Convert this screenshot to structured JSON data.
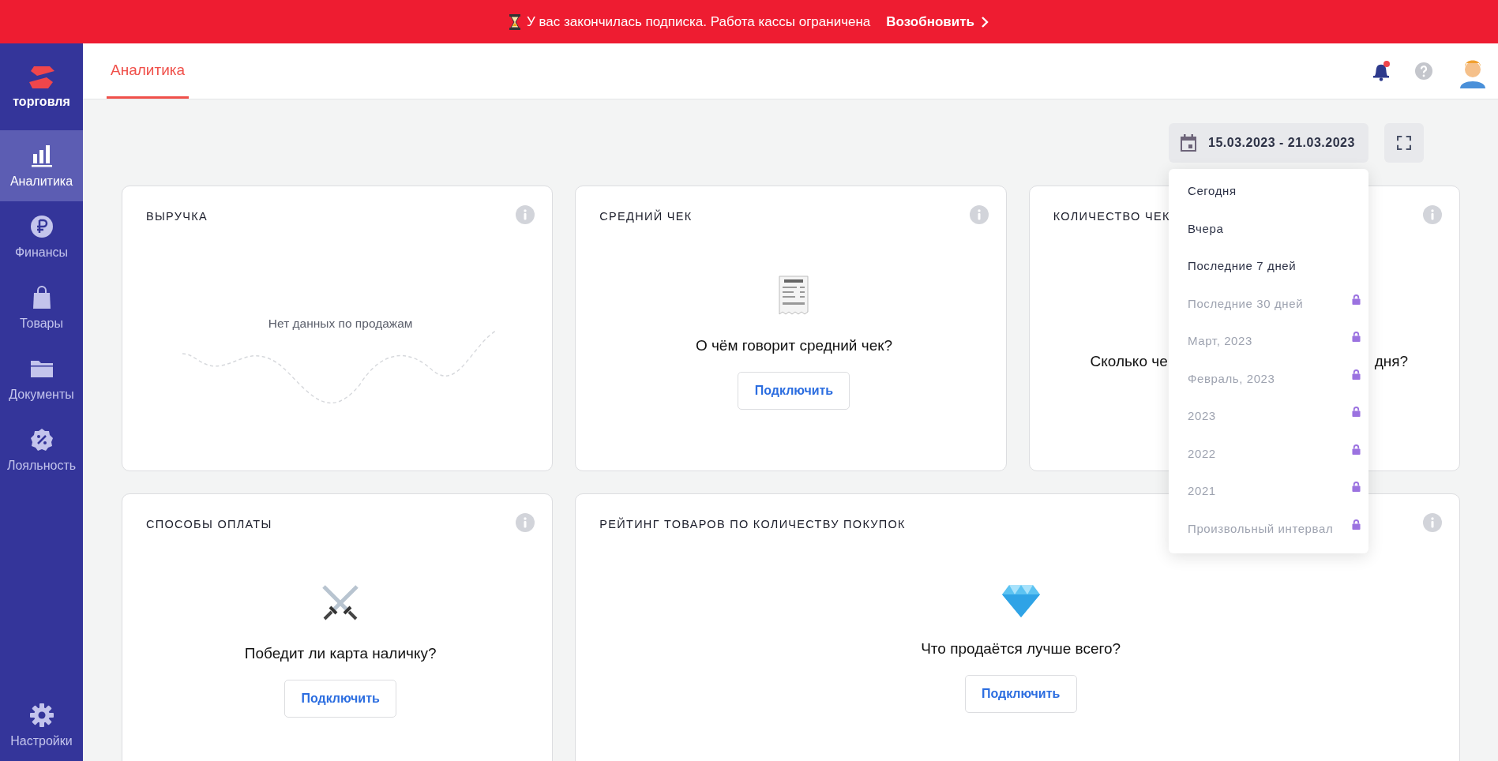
{
  "banner": {
    "message": "У вас закончилась подписка. Работа кассы ограничена",
    "action": "Возобновить"
  },
  "sidebar": {
    "logo": "торговля",
    "items": [
      {
        "label": "Аналитика",
        "selected": true
      },
      {
        "label": "Финансы",
        "selected": false
      },
      {
        "label": "Товары",
        "selected": false
      },
      {
        "label": "Документы",
        "selected": false
      },
      {
        "label": "Лояльность",
        "selected": false
      }
    ],
    "footer_item": {
      "label": "Настройки",
      "selected": false
    }
  },
  "header": {
    "tabs": [
      {
        "label": "Аналитика",
        "selected": true
      }
    ],
    "notifications_unread": true
  },
  "date_range": {
    "value": "15.03.2023 - 21.03.2023",
    "options": [
      {
        "label": "Сегодня",
        "locked": false
      },
      {
        "label": "Вчера",
        "locked": false
      },
      {
        "label": "Последние 7 дней",
        "locked": false
      },
      {
        "label": "Последние 30 дней",
        "locked": true
      },
      {
        "label": "Март, 2023",
        "locked": true
      },
      {
        "label": "Февраль, 2023",
        "locked": true
      },
      {
        "label": "2023",
        "locked": true
      },
      {
        "label": "2022",
        "locked": true
      },
      {
        "label": "2021",
        "locked": true
      },
      {
        "label": "Произвольный интервал",
        "locked": true
      }
    ]
  },
  "cards": [
    {
      "kind": "empty_chart",
      "title": "ВЫРУЧКА",
      "message": "Нет данных по продажам"
    },
    {
      "kind": "promo",
      "title": "СРЕДНИЙ ЧЕК",
      "question": "О чём говорит средний чек?",
      "button": "Подключить"
    },
    {
      "kind": "covered",
      "title": "КОЛИЧЕСТВО ЧЕК",
      "question_parts": [
        "Сколько че",
        "дня?"
      ]
    },
    {
      "kind": "promo",
      "title": "СПОСОБЫ ОПЛАТЫ",
      "question": "Победит ли карта наличку?",
      "button": "Подключить"
    },
    {
      "kind": "promo",
      "title": "РЕЙТИНГ ТОВАРОВ ПО КОЛИЧЕСТВУ ПОКУПОК",
      "question": "Что продаётся лучше всего?",
      "button": "Подключить"
    }
  ]
}
